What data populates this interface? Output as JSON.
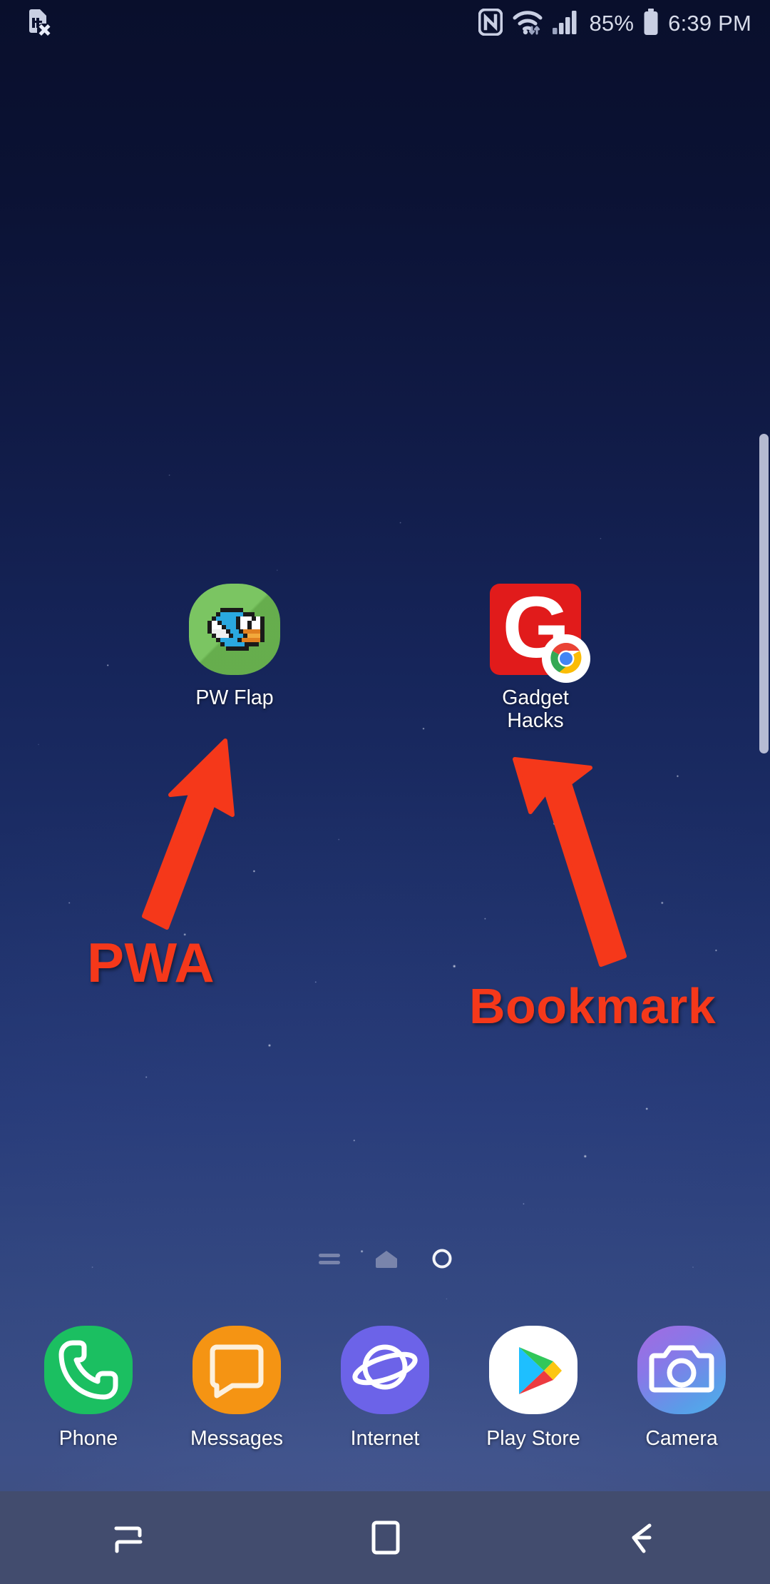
{
  "status_bar": {
    "left_icons": [
      {
        "name": "no-sim-card-icon",
        "label": "No SIM card"
      }
    ],
    "right_icons": [
      {
        "name": "nfc-icon",
        "label": "NFC"
      },
      {
        "name": "wifi-icon",
        "label": "Wi-Fi"
      },
      {
        "name": "signal-bars-icon",
        "label": "Signal"
      },
      {
        "name": "battery-icon",
        "label": "Battery"
      }
    ],
    "battery_percent": "85%",
    "time": "6:39 PM"
  },
  "home_screen": {
    "apps": [
      {
        "name": "pw-flap",
        "label": "PW Flap",
        "icon": "pw-flap-icon",
        "bg_color": "#71c156"
      },
      {
        "name": "gadget-hacks",
        "label": "Gadget\nHacks",
        "icon": "gadget-hacks-icon",
        "bg_color": "#e11b1b",
        "badge": "chrome-badge-icon"
      }
    ]
  },
  "annotations": [
    {
      "name": "pwa-annotation",
      "text": "PWA",
      "color": "#f5381a",
      "points_to": "PW Flap"
    },
    {
      "name": "bookmark-annotation",
      "text": "Bookmark",
      "color": "#f5381a",
      "points_to": "Gadget Hacks"
    }
  ],
  "page_indicator": {
    "items": [
      {
        "name": "page-dot-feed",
        "type": "feed",
        "active": false
      },
      {
        "name": "page-dot-home",
        "type": "home",
        "active": false
      },
      {
        "name": "page-dot-current",
        "type": "circle",
        "active": true
      }
    ]
  },
  "dock": {
    "apps": [
      {
        "name": "phone",
        "label": "Phone",
        "icon": "phone-icon",
        "bg_color": "#1bbf61"
      },
      {
        "name": "messages",
        "label": "Messages",
        "icon": "message-bubble-icon",
        "bg_color": "#f59413"
      },
      {
        "name": "internet",
        "label": "Internet",
        "icon": "planet-icon",
        "bg_color": "#6c63e8"
      },
      {
        "name": "play-store",
        "label": "Play Store",
        "icon": "play-store-icon",
        "bg_color": "#ffffff"
      },
      {
        "name": "camera",
        "label": "Camera",
        "icon": "camera-icon",
        "bg_color": "#7f86e6"
      }
    ]
  },
  "nav_bar": {
    "buttons": [
      {
        "name": "recents-button",
        "icon": "recents-icon"
      },
      {
        "name": "home-button",
        "icon": "home-square-icon"
      },
      {
        "name": "back-button",
        "icon": "back-arrow-icon"
      }
    ]
  }
}
